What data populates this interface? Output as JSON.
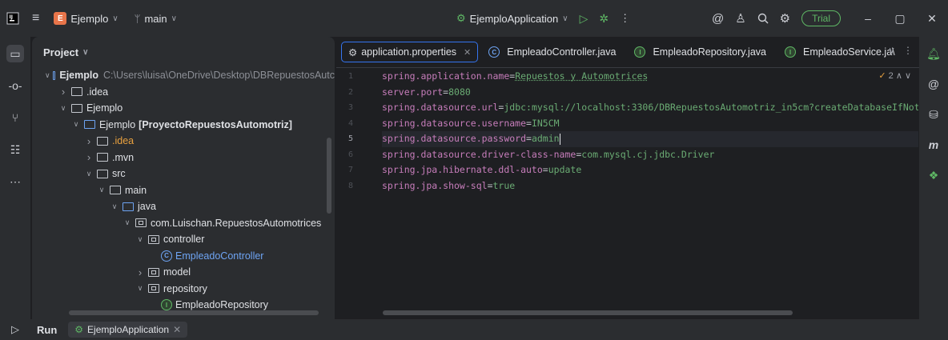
{
  "titlebar": {
    "project_badge": "E",
    "project_name": "Ejemplo",
    "branch": "main",
    "run_config": "EjemploApplication",
    "trial_label": "Trial"
  },
  "project_panel": {
    "title": "Project",
    "tree": [
      {
        "indent": 0,
        "twisty": "open",
        "icon": "module",
        "label": "Ejemplo",
        "bold": true,
        "path": "C:\\Users\\luisa\\OneDrive\\Desktop\\DBRepuestosAutc"
      },
      {
        "indent": 1,
        "twisty": "closed",
        "icon": "folder",
        "label": ".idea"
      },
      {
        "indent": 1,
        "twisty": "open",
        "icon": "folder",
        "label": "Ejemplo"
      },
      {
        "indent": 2,
        "twisty": "open",
        "icon": "module",
        "label": "Ejemplo",
        "suffix": "[ProyectoRepuestosAutomotriz]"
      },
      {
        "indent": 3,
        "twisty": "closed",
        "icon": "folder",
        "label": ".idea",
        "color": "orange"
      },
      {
        "indent": 3,
        "twisty": "closed",
        "icon": "folder",
        "label": ".mvn"
      },
      {
        "indent": 3,
        "twisty": "open",
        "icon": "folder",
        "label": "src"
      },
      {
        "indent": 4,
        "twisty": "open",
        "icon": "folder",
        "label": "main"
      },
      {
        "indent": 5,
        "twisty": "open",
        "icon": "folder-blue",
        "label": "java"
      },
      {
        "indent": 6,
        "twisty": "open",
        "icon": "package",
        "label": "com.Luischan.RepuestosAutomotrices"
      },
      {
        "indent": 7,
        "twisty": "open",
        "icon": "package",
        "label": "controller"
      },
      {
        "indent": 8,
        "twisty": "none",
        "icon": "class",
        "label": "EmpleadoController",
        "color": "blue"
      },
      {
        "indent": 7,
        "twisty": "closed",
        "icon": "package",
        "label": "model"
      },
      {
        "indent": 7,
        "twisty": "open",
        "icon": "package",
        "label": "repository"
      },
      {
        "indent": 8,
        "twisty": "none",
        "icon": "interface",
        "label": "EmpleadoRepository"
      }
    ]
  },
  "editor": {
    "tabs": [
      {
        "label": "application.properties",
        "icon": "gear",
        "active": true,
        "closable": true
      },
      {
        "label": "EmpleadoController.java",
        "icon": "class",
        "active": false
      },
      {
        "label": "EmpleadoRepository.java",
        "icon": "interface",
        "active": false
      },
      {
        "label": "EmpleadoService.ja\\",
        "icon": "interface",
        "active": false
      }
    ],
    "inspection_count": "2",
    "current_line": 5,
    "lines": [
      {
        "key": "spring.application.name",
        "value": "Repuestos y Automotrices"
      },
      {
        "key": "server.port",
        "value": "8080"
      },
      {
        "key": "spring.datasource.url",
        "value": "jdbc:mysql://localhost:3306/DBRepuestosAutomotriz_in5cm?createDatabaseIfNotE"
      },
      {
        "key": "spring.datasource.username",
        "value": "IN5CM"
      },
      {
        "key": "spring.datasource.password",
        "value": "admin"
      },
      {
        "key": "spring.datasource.driver-class-name",
        "value": "com.mysql.cj.jdbc.Driver"
      },
      {
        "key": "spring.jpa.hibernate.ddl-auto",
        "value": "update"
      },
      {
        "key": "spring.jpa.show-sql",
        "value": "true"
      }
    ]
  },
  "bottom": {
    "run_label": "Run",
    "run_tab": "EjemploApplication"
  }
}
